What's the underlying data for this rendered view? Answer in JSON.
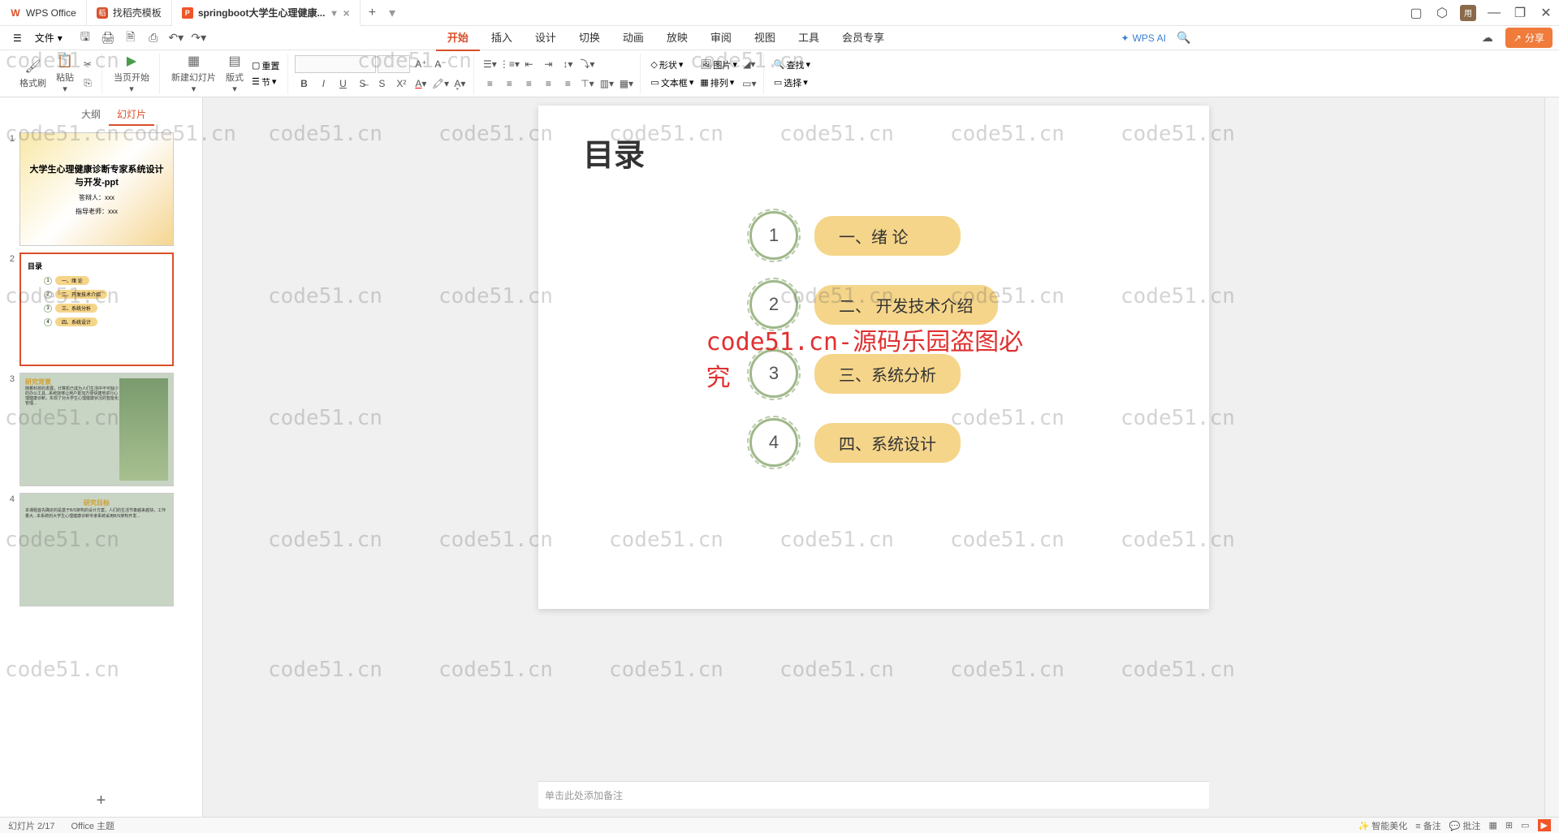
{
  "tabs": [
    {
      "label": "WPS Office",
      "icon_color": "#d94f2a"
    },
    {
      "label": "找稻壳模板",
      "icon_color": "#d94f2a"
    },
    {
      "label": "springboot大学生心理健康...",
      "icon_color": "#f0552a",
      "active": true
    }
  ],
  "menubar": {
    "file": "文件",
    "tabs": [
      "开始",
      "插入",
      "设计",
      "切换",
      "动画",
      "放映",
      "审阅",
      "视图",
      "工具",
      "会员专享"
    ],
    "active_tab": "开始",
    "wps_ai": "WPS AI",
    "share": "分享"
  },
  "ribbon": {
    "format_painter": "格式刷",
    "paste": "粘贴",
    "from_current": "当页开始",
    "new_slide": "新建幻灯片",
    "layout": "版式",
    "section": "节",
    "reset": "重置",
    "shape": "形状",
    "picture": "图片",
    "textbox": "文本框",
    "arrange": "排列",
    "find": "查找",
    "select": "选择"
  },
  "panel": {
    "tabs": [
      "大纲",
      "幻灯片"
    ],
    "active": "幻灯片"
  },
  "thumbnails": [
    {
      "num": "1",
      "title": "大学生心理健康诊断专家系统设计与开发-ppt",
      "author": "答辩人：xxx",
      "advisor": "指导老师：xxx"
    },
    {
      "num": "2",
      "title": "目录",
      "items": [
        "一、绪 论",
        "二、开发技术介绍",
        "三、系统分析",
        "四、系统设计"
      ]
    },
    {
      "num": "3",
      "title": "研究背景"
    },
    {
      "num": "4",
      "title": "研究目标"
    }
  ],
  "slide": {
    "title": "目录",
    "toc": [
      {
        "num": "1",
        "label": "一、绪  论"
      },
      {
        "num": "2",
        "label": "二、 开发技术介绍"
      },
      {
        "num": "3",
        "label": "三、系统分析"
      },
      {
        "num": "4",
        "label": "四、系统设计"
      }
    ]
  },
  "notes_placeholder": "单击此处添加备注",
  "watermark_text": "code51.cn",
  "center_watermark": "code51.cn-源码乐园盗图必究",
  "statusbar": {
    "slide_info": "幻灯片 2/17",
    "office": "Office 主题",
    "beautify": "智能美化",
    "notes": "备注",
    "comments": "批注"
  }
}
